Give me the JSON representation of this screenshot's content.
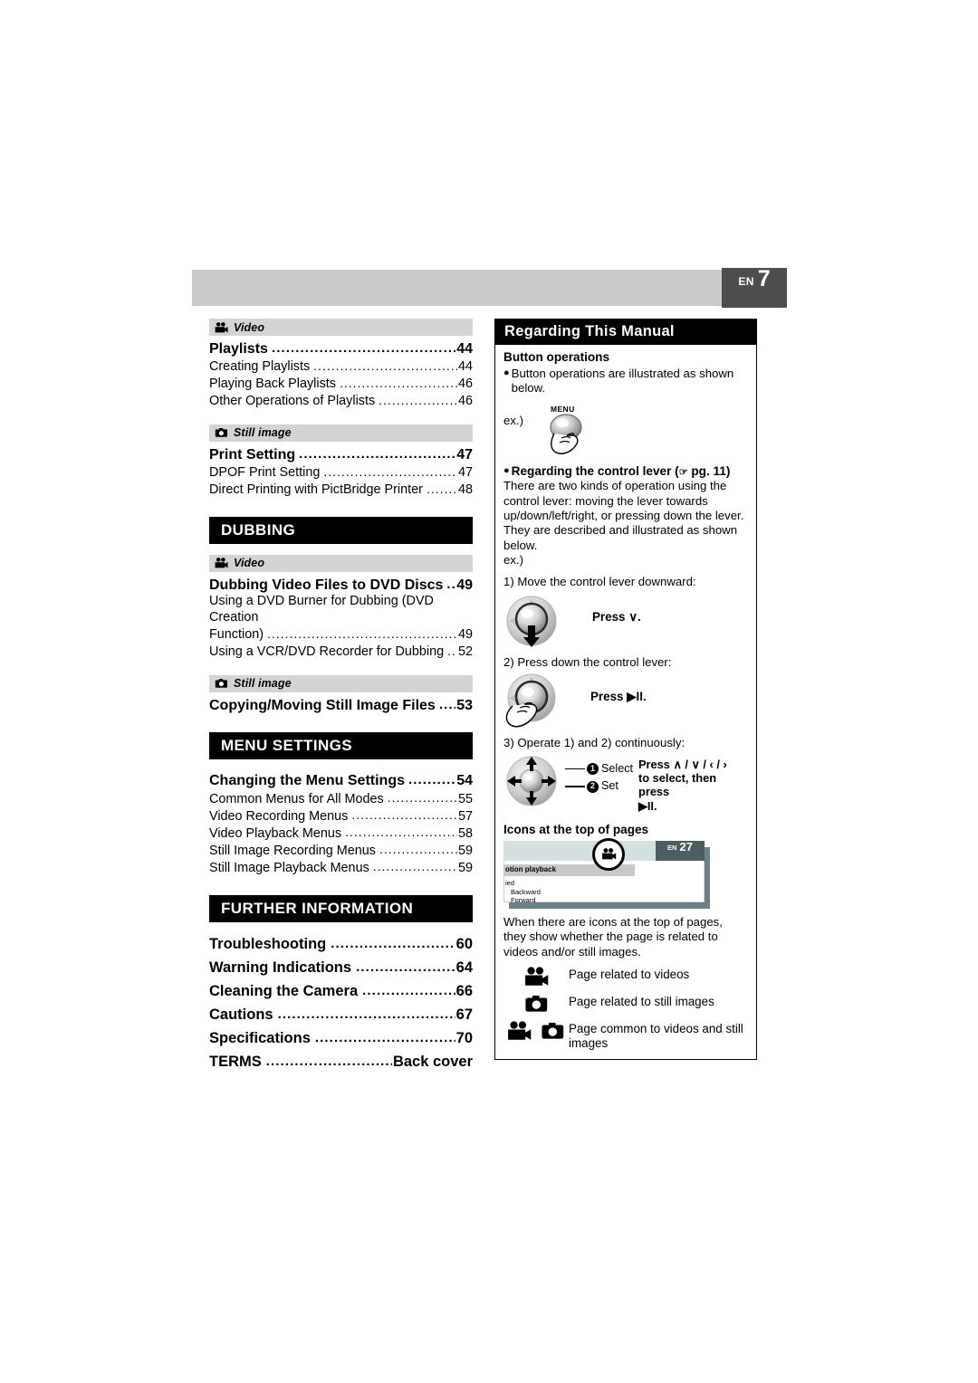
{
  "header": {
    "lang_code": "EN",
    "page_number": "7"
  },
  "left_column": {
    "groups": [
      {
        "category": {
          "icon": "camcorder-icon",
          "label": "Video"
        },
        "entries": [
          {
            "type": "main",
            "title": "Playlists",
            "page": "44"
          },
          {
            "type": "sub",
            "title": "Creating Playlists",
            "page": "44"
          },
          {
            "type": "sub",
            "title": "Playing Back Playlists",
            "page": "46"
          },
          {
            "type": "sub",
            "title": "Other Operations of Playlists",
            "page": "46"
          }
        ]
      },
      {
        "category": {
          "icon": "still-camera-icon",
          "label": "Still image"
        },
        "entries": [
          {
            "type": "main",
            "title": "Print Setting",
            "page": "47"
          },
          {
            "type": "sub",
            "title": "DPOF Print Setting",
            "page": "47"
          },
          {
            "type": "sub",
            "title": "Direct Printing with PictBridge Printer",
            "page": "48"
          }
        ]
      }
    ],
    "section_dubbing": {
      "heading": "DUBBING",
      "groups": [
        {
          "category": {
            "icon": "camcorder-icon",
            "label": "Video"
          },
          "entries": [
            {
              "type": "main",
              "title": "Dubbing Video Files to DVD Discs",
              "page": "49"
            },
            {
              "type": "sub-wrap",
              "title_line1": "Using a DVD Burner for Dubbing (DVD Creation",
              "title_line2": "Function)",
              "page": "49"
            },
            {
              "type": "sub",
              "title": "Using a VCR/DVD Recorder for Dubbing",
              "page": "52"
            }
          ]
        },
        {
          "category": {
            "icon": "still-camera-icon",
            "label": "Still image"
          },
          "entries": [
            {
              "type": "main",
              "title": "Copying/Moving Still Image Files",
              "page": "53"
            }
          ]
        }
      ]
    },
    "section_menu": {
      "heading": "MENU SETTINGS",
      "entries": [
        {
          "type": "main",
          "title": "Changing the Menu Settings",
          "page": "54"
        },
        {
          "type": "sub",
          "title": "Common Menus for All Modes",
          "page": "55"
        },
        {
          "type": "sub",
          "title": "Video Recording Menus",
          "page": "57"
        },
        {
          "type": "sub",
          "title": "Video Playback Menus",
          "page": "58"
        },
        {
          "type": "sub",
          "title": "Still Image Recording Menus",
          "page": "59"
        },
        {
          "type": "sub",
          "title": "Still Image Playback Menus",
          "page": "59"
        }
      ]
    },
    "section_further": {
      "heading": "FURTHER INFORMATION",
      "entries": [
        {
          "type": "big",
          "title": "Troubleshooting",
          "page": "60"
        },
        {
          "type": "big",
          "title": "Warning Indications",
          "page": "64"
        },
        {
          "type": "big",
          "title": "Cleaning the Camera",
          "page": "66"
        },
        {
          "type": "big",
          "title": "Cautions",
          "page": "67"
        },
        {
          "type": "big",
          "title": "Specifications",
          "page": "70"
        },
        {
          "type": "big",
          "title": "TERMS",
          "page": "Back cover"
        }
      ]
    }
  },
  "right_panel": {
    "title": "Regarding This Manual",
    "button_operations": {
      "heading": "Button operations",
      "bullet": "Button operations are illustrated as shown below.",
      "ex_label": "ex.)",
      "menu_button_label": "MENU"
    },
    "control_lever": {
      "heading": "Regarding the control lever (",
      "heading_ref": "pg. 11",
      "heading_close": ")",
      "body": "There are two kinds of operation using the control lever: moving the lever towards up/down/left/right, or pressing down the lever. They are described and illustrated as shown below.",
      "ex_label": "ex.)",
      "step1": {
        "label": "1) Move the control lever downward:",
        "press": "Press",
        "symbol": "∨",
        "suffix": "."
      },
      "step2": {
        "label": "2) Press down the control lever:",
        "press": "Press",
        "symbol": "▶II",
        "suffix": "."
      },
      "step3": {
        "label": "3) Operate 1) and 2) continuously:",
        "callout1_num": "❶",
        "callout1": "Select",
        "callout2_num": "❷",
        "callout2": "Set",
        "press_line1": "Press",
        "press_symbols": "∧ / ∨ / ‹ / ›",
        "press_line2": "to select, then press",
        "press_line3": "▶II."
      }
    },
    "icons_section": {
      "heading": "Icons at the top of pages",
      "mini_page": {
        "badge_lang": "EN",
        "badge_num": "27",
        "bar_text": "otion playback",
        "line1": "ied",
        "line2": "Backward",
        "line3": "Forward",
        "circled_icon": "camcorder-icon"
      },
      "description": "When there are icons at the top of pages, they show whether the page is related to videos and/or still images.",
      "legend": [
        {
          "icons": [
            "camcorder-icon"
          ],
          "text": "Page related to videos"
        },
        {
          "icons": [
            "still-camera-icon"
          ],
          "text": "Page related to still images"
        },
        {
          "icons": [
            "camcorder-icon",
            "still-camera-icon"
          ],
          "text": "Page common to videos and still images"
        }
      ]
    }
  },
  "colors": {
    "header_bar": "#cacaca",
    "header_badge": "#4d4d4d",
    "category_bar": "#d4d4d4",
    "section_bar": "#000000",
    "mini_page_shadow": "#6c8086",
    "mini_page_top": "#d5e0e2",
    "mini_badge": "#4d5e63"
  }
}
